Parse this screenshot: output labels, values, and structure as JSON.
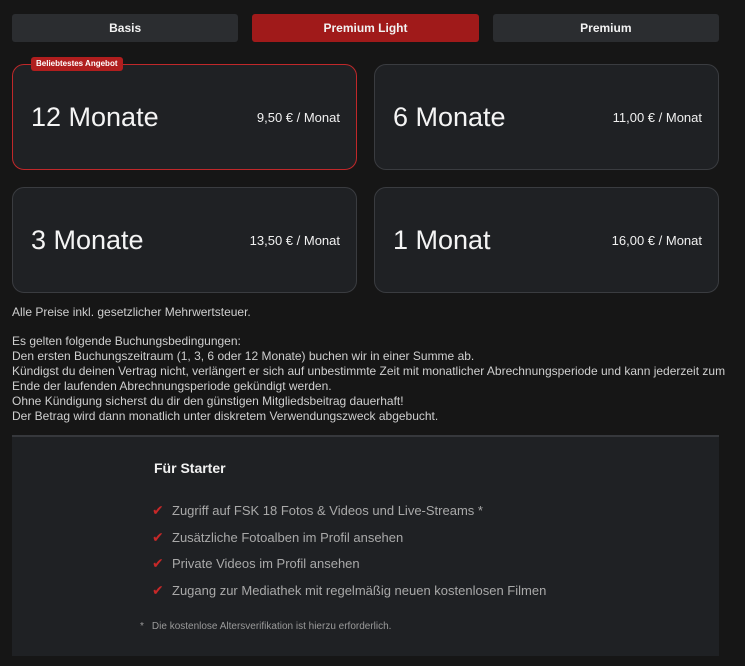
{
  "tabs": [
    {
      "label": "Basis",
      "active": false
    },
    {
      "label": "Premium Light",
      "active": true
    },
    {
      "label": "Premium",
      "active": false
    }
  ],
  "plans": [
    {
      "name": "12 Monate",
      "price": "9,50 € / Monat",
      "badge": "Beliebtestes Angebot",
      "featured": true
    },
    {
      "name": "6 Monate",
      "price": "11,00 € / Monat"
    },
    {
      "name": "3 Monate",
      "price": "13,50 € / Monat"
    },
    {
      "name": "1 Monat",
      "price": "16,00 € / Monat"
    }
  ],
  "notes": {
    "vat": "Alle Preise inkl. gesetzlicher Mehrwertsteuer.",
    "lines": [
      "Es gelten folgende Buchungsbedingungen:",
      "Den ersten Buchungszeitraum (1, 3, 6 oder 12 Monate) buchen wir in einer Summe ab.",
      "Kündigst du deinen Vertrag nicht, verlängert er sich auf unbestimmte Zeit mit monatlicher Abrechnungsperiode und kann jederzeit zum Ende der laufenden Abrechnungsperiode gekündigt werden.",
      "Ohne Kündigung sicherst du dir den günstigen Mitgliedsbeitrag dauerhaft!",
      "Der Betrag wird dann monatlich unter diskretem Verwendungszweck abgebucht."
    ]
  },
  "features": {
    "title": "Für Starter",
    "items": [
      "Zugriff auf FSK 18 Fotos & Videos und Live-Streams *",
      "Zusätzliche Fotoalben im Profil ansehen",
      "Private Videos im Profil ansehen",
      "Zugang zur Mediathek mit regelmäßig neuen kostenlosen Filmen"
    ],
    "footnote_mark": "*",
    "footnote": "Die kostenlose Altersverifikation ist hierzu erforderlich."
  },
  "colors": {
    "accent": "#a01a1a",
    "featured_border": "#c0282a",
    "check": "#c62828",
    "card": "#1f2124",
    "background": "#161616"
  },
  "icons": {
    "check": "check-icon"
  }
}
